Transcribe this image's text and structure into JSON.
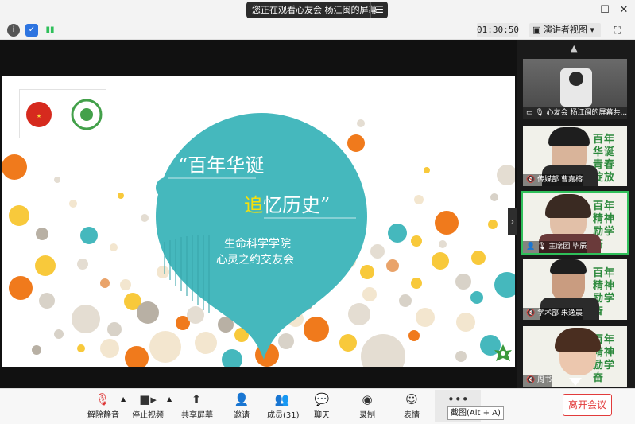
{
  "titlebar": {
    "share_status": "您正在观看心友会 杨江闽的屏幕",
    "menu_icon": "list-icon",
    "controls": [
      "minimize-icon",
      "maximize-icon",
      "close-icon"
    ]
  },
  "toprow": {
    "timer": "01:30:50",
    "view_label": "演讲者视图",
    "icons": [
      "info-icon",
      "shield-icon",
      "signal-icon",
      "fullscreen-icon"
    ]
  },
  "slide": {
    "title_line1": "“百年华诞",
    "title_line2_highlight": "追",
    "title_line2_rest": "忆历史”",
    "subtitle1": "生命科学学院",
    "subtitle2": "心灵之约交友会",
    "colors": {
      "teal": "#45b8bd",
      "orange": "#f07a1c",
      "yellow": "#f5e00b"
    }
  },
  "participants": [
    {
      "label": "心友会 杨江闽的屏幕共..."
    },
    {
      "label": "传媒部 曹嘉榕",
      "bg": "百年华诞 青春绽放"
    },
    {
      "label": "主席团 毕辰",
      "bg": "百年精神 励学奋"
    },
    {
      "label": "学术部 朱逸晨",
      "bg": "百年精神 励学奋"
    },
    {
      "label": "周书",
      "bg": "百年精神 励学奋"
    }
  ],
  "bottombar": {
    "unmute": "解除静音",
    "stop_video": "停止视频",
    "share_screen": "共享屏幕",
    "invite": "邀请",
    "members": "成员(31)",
    "chat": "聊天",
    "record": "录制",
    "reactions": "表情",
    "screenshot_tooltip": "截图(Alt + A)",
    "leave": "离开会议"
  }
}
